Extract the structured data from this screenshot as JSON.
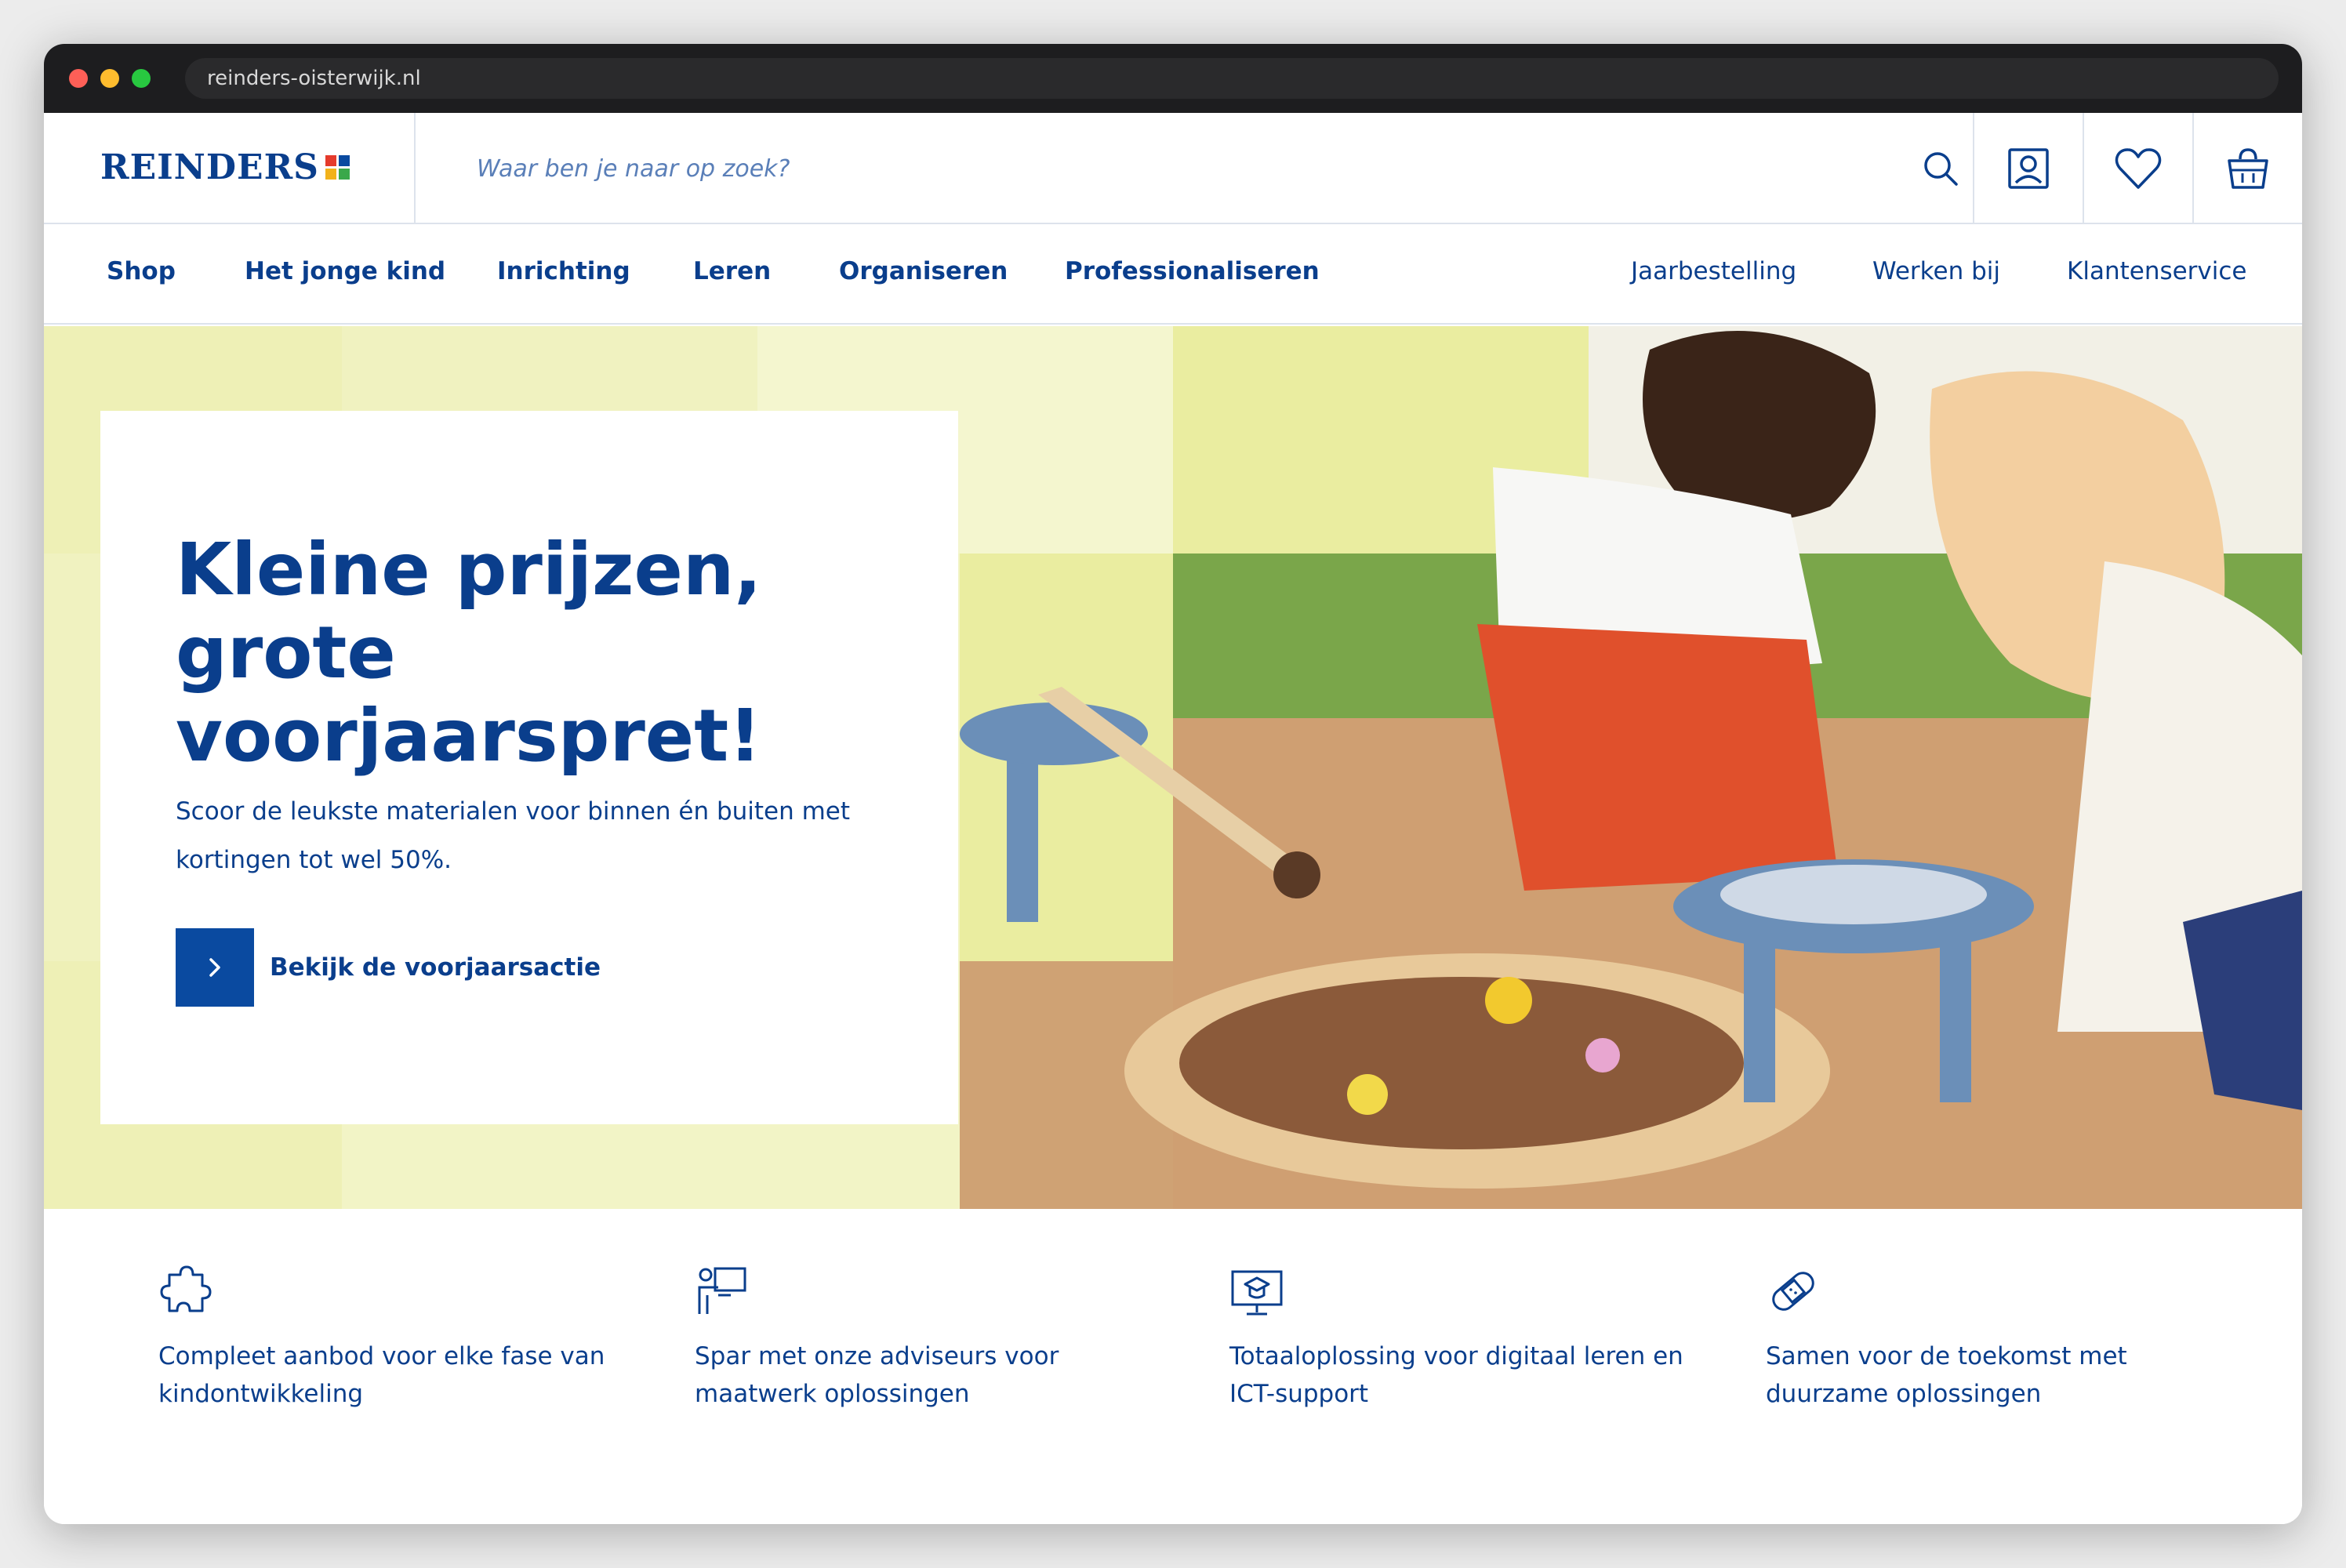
{
  "browser": {
    "url": "reinders-oisterwijk.nl"
  },
  "header": {
    "logo": "REINDERS",
    "search_placeholder": "Waar ben je naar op zoek?",
    "icons": [
      "search-icon",
      "account-icon",
      "heart-icon",
      "basket-icon"
    ]
  },
  "nav": {
    "left": [
      "Shop",
      "Het jonge kind",
      "Inrichting",
      "Leren",
      "Organiseren",
      "Professionaliseren"
    ],
    "right": [
      "Jaarbestelling",
      "Werken bij",
      "Klantenservice"
    ]
  },
  "hero": {
    "title": "Kleine prijzen, grote voorjaarspret!",
    "text": "Scoor de leukste materialen voor binnen én buiten met kortingen tot wel 50%.",
    "cta": "Bekijk de voorjaarsactie"
  },
  "usps": [
    {
      "icon": "puzzle-icon",
      "text": "Compleet aanbod voor elke fase van kindontwikkeling"
    },
    {
      "icon": "teacher-icon",
      "text": "Spar met onze adviseurs voor maatwerk oplossingen"
    },
    {
      "icon": "digital-learning-icon",
      "text": "Totaaloplossing voor digitaal leren en ICT-support"
    },
    {
      "icon": "bandage-icon",
      "text": "Samen voor de toekomst met duurzame oplossingen"
    }
  ],
  "colors": {
    "brand": "#0a3e8c",
    "hero_bg": "#f2f4c6",
    "accent_tile": "#eaeda0"
  }
}
